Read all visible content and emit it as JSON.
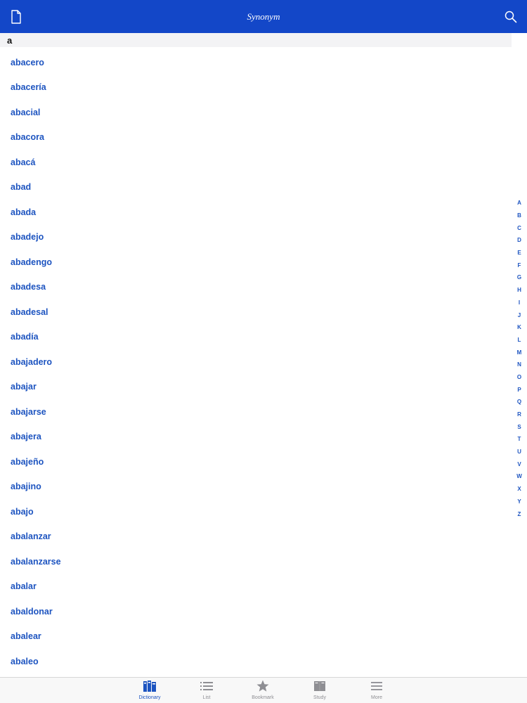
{
  "header": {
    "title": "Synonym",
    "left_icon": "document-icon",
    "right_icon": "search-icon",
    "background": "#1347c8"
  },
  "section": {
    "letter": "a"
  },
  "words": [
    "abacero",
    "abacería",
    "abacial",
    "abacora",
    "abacá",
    "abad",
    "abada",
    "abadejo",
    "abadengo",
    "abadesa",
    "abadesal",
    "abadía",
    "abajadero",
    "abajar",
    "abajarse",
    "abajera",
    "abajeño",
    "abajino",
    "abajo",
    "abalanzar",
    "abalanzarse",
    "abalar",
    "abaldonar",
    "abalear",
    "abaleo"
  ],
  "index_letters": [
    "A",
    "B",
    "C",
    "D",
    "E",
    "F",
    "G",
    "H",
    "I",
    "J",
    "K",
    "L",
    "M",
    "N",
    "O",
    "P",
    "Q",
    "R",
    "S",
    "T",
    "U",
    "V",
    "W",
    "X",
    "Y",
    "Z"
  ],
  "tabs": [
    {
      "label": "Dictionary",
      "icon": "dictionary-icon",
      "active": true
    },
    {
      "label": "List",
      "icon": "list-icon",
      "active": false
    },
    {
      "label": "Bookmark",
      "icon": "star-icon",
      "active": false
    },
    {
      "label": "Study",
      "icon": "book-icon",
      "active": false
    },
    {
      "label": "More",
      "icon": "menu-icon",
      "active": false
    }
  ],
  "colors": {
    "accent": "#1d54c0",
    "inactive": "#8e8e93"
  }
}
